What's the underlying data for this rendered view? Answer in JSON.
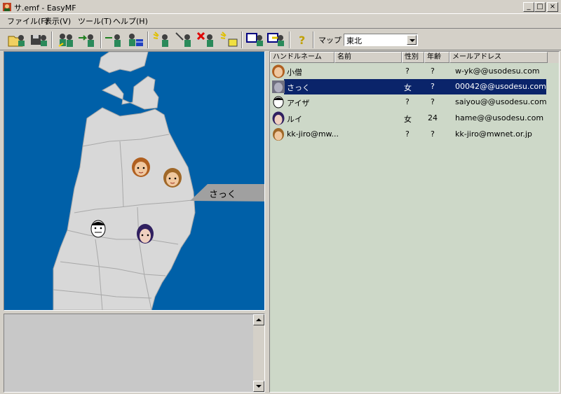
{
  "window": {
    "title": "サ.emf - EasyMF",
    "min_label": "_",
    "max_label": "□",
    "close_label": "×"
  },
  "menu": [
    "ファイル(F)",
    "表示(V)",
    "ツール(T)",
    "ヘルプ(H)"
  ],
  "toolbar": {
    "buttons": [
      "open-file",
      "save-file",
      "user-group",
      "user-link",
      "user-add",
      "user-map",
      "flash-user",
      "edit-user",
      "delete-user",
      "flash-note",
      "window-user",
      "window-transfer",
      "help"
    ],
    "map_label": "マップ",
    "map_value": "東北"
  },
  "map": {
    "callout_label": "さっく",
    "land_color": "#d8d8d8",
    "sea_color": "#0060a8"
  },
  "list": {
    "columns": [
      "ハンドルネーム",
      "名前",
      "性別",
      "年齢",
      "メールアドレス"
    ],
    "rows": [
      {
        "handle": "小僧",
        "name": "",
        "gender": "?",
        "age": "?",
        "email": "w-yk@@usodesu.com",
        "selected": false,
        "icon": "woman-avatar-icon"
      },
      {
        "handle": "さっく",
        "name": "",
        "gender": "女",
        "age": "?",
        "email": "00042@@usodesu.com",
        "selected": true,
        "icon": "gray-avatar-icon"
      },
      {
        "handle": "アイザ",
        "name": "",
        "gender": "?",
        "age": "?",
        "email": "saiyou@@usodesu.com",
        "selected": false,
        "icon": "man-avatar-icon"
      },
      {
        "handle": "ルイ",
        "name": "",
        "gender": "女",
        "age": "24",
        "email": "hame@@usodesu.com",
        "selected": false,
        "icon": "purple-hair-avatar-icon"
      },
      {
        "handle": "kk-jiro@mw...",
        "name": "",
        "gender": "?",
        "age": "?",
        "email": "kk-jiro@mwnet.or.jp",
        "selected": false,
        "icon": "boy-avatar-icon"
      }
    ]
  },
  "colors": {
    "selection": "#0a246a",
    "list_bg": "#cdd8c8"
  }
}
